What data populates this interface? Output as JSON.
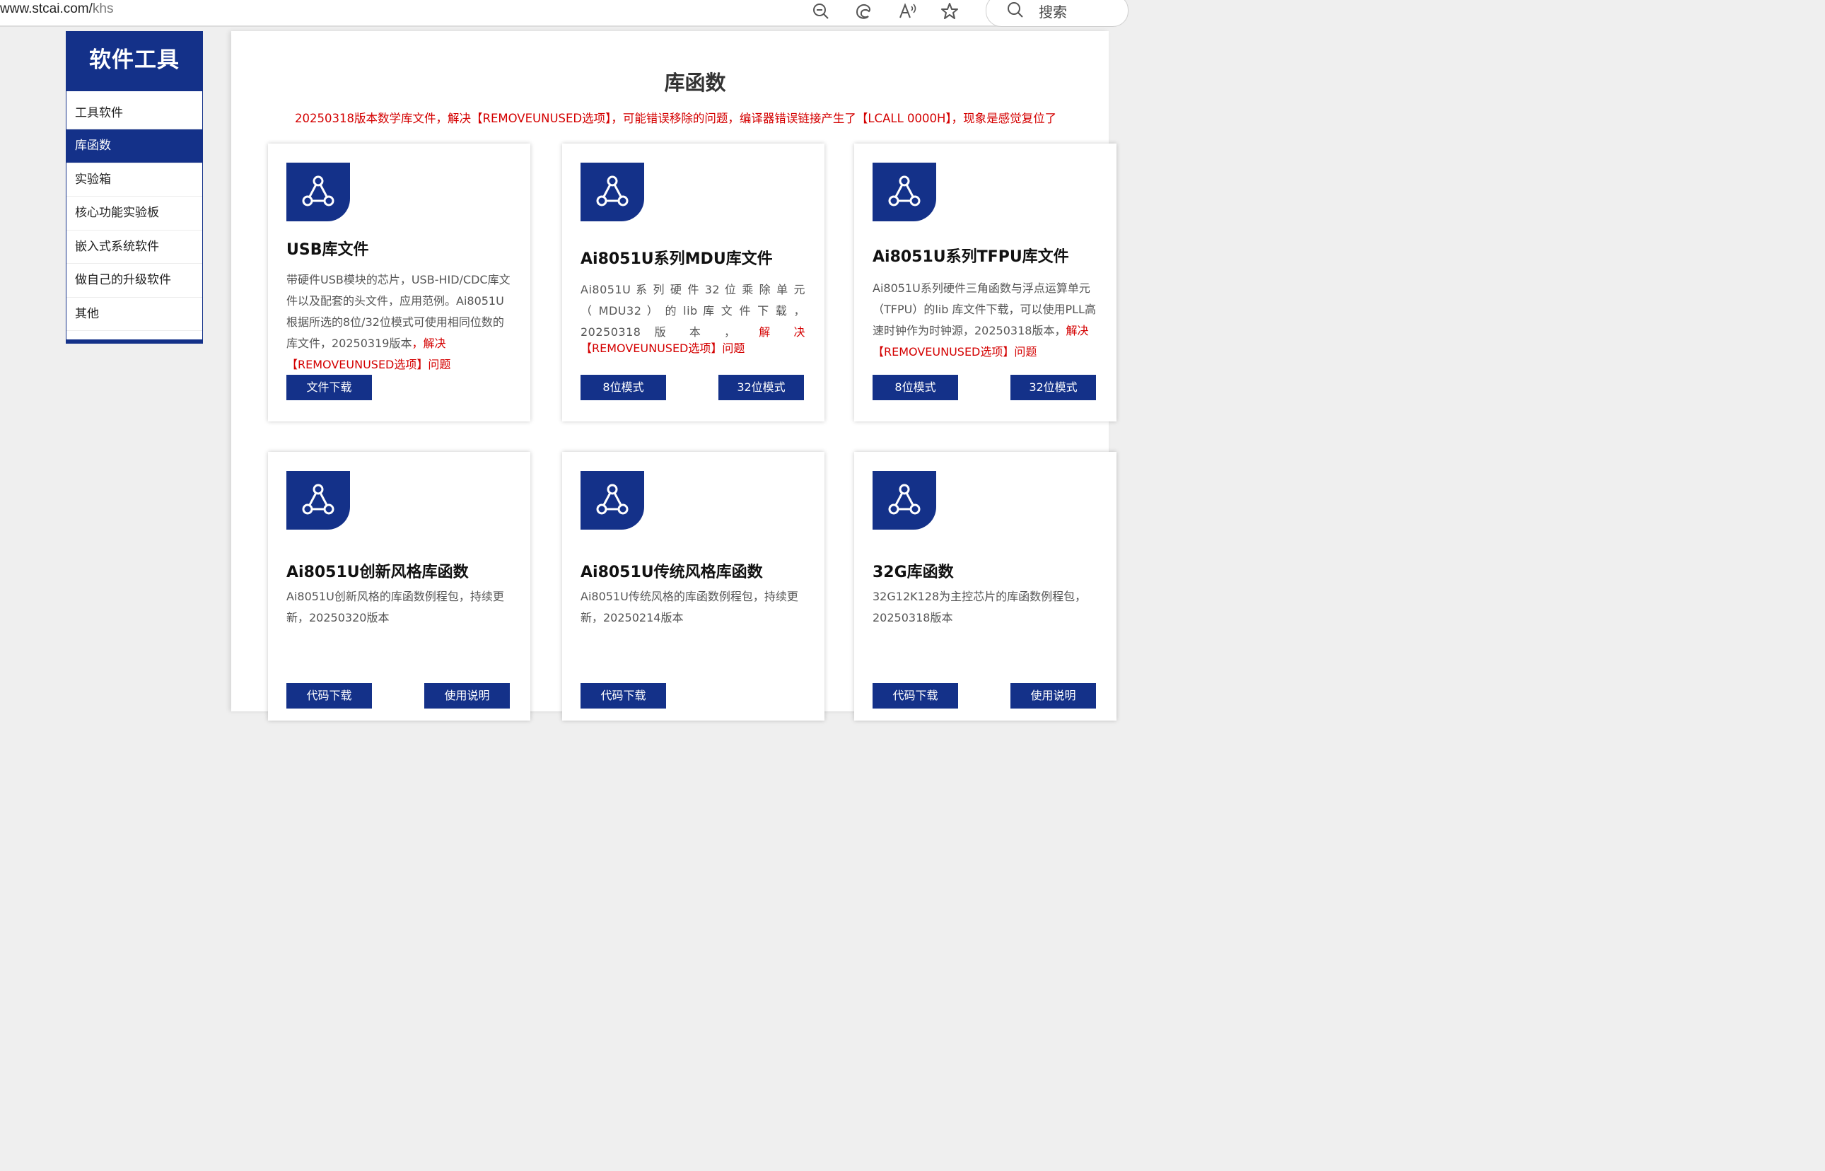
{
  "browser": {
    "url_host": "www.stcai.com/",
    "url_path": "khs",
    "search_label": "搜索"
  },
  "sidebar": {
    "title": "软件工具",
    "items": [
      {
        "label": "工具软件"
      },
      {
        "label": "库函数"
      },
      {
        "label": "实验箱"
      },
      {
        "label": "核心功能实验板"
      },
      {
        "label": "嵌入式系统软件"
      },
      {
        "label": "做自己的升级软件"
      },
      {
        "label": "其他"
      }
    ]
  },
  "main": {
    "title": "库函数",
    "notice": "20250318版本数学库文件，解决【REMOVEUNUSED选项】，可能错误移除的问题，编译器错误链接产生了【LCALL  0000H】，现象是感觉复位了",
    "cards": [
      {
        "title": "USB库文件",
        "desc": "带硬件USB模块的芯片，USB-HID/CDC库文件以及配套的头文件，应用范例。Ai8051U根据所选的8位/32位模式可使用相同位数的库文件，20250319版本",
        "desc_red": "，解决【REMOVEUNUSED选项】问题",
        "buttons": [
          "文件下载"
        ]
      },
      {
        "title": "Ai8051U系列MDU库文件",
        "desc": "Ai8051U 系 列 硬 件 32 位 乘 除 单 元 （ MDU32 ） 的 lib 库 文 件 下 载 ， 20250318 版 本 ，",
        "desc_red": "解 决",
        "desc_red2": "【REMOVEUNUSED选项】问题",
        "buttons": [
          "8位模式",
          "32位模式"
        ]
      },
      {
        "title": "Ai8051U系列TFPU库文件",
        "desc": "Ai8051U系列硬件三角函数与浮点运算单元（TFPU）的lib 库文件下载，可以使用PLL高速时钟作为时钟源，20250318版本，",
        "desc_red": "解决【REMOVEUNUSED选项】问题",
        "buttons": [
          "8位模式",
          "32位模式"
        ]
      },
      {
        "title": "Ai8051U创新风格库函数",
        "desc": "Ai8051U创新风格的库函数例程包，持续更新，20250320版本",
        "buttons": [
          "代码下载",
          "使用说明"
        ]
      },
      {
        "title": "Ai8051U传统风格库函数",
        "desc": "Ai8051U传统风格的库函数例程包，持续更新，20250214版本",
        "buttons": [
          "代码下载"
        ]
      },
      {
        "title": "32G库函数",
        "desc": "32G12K128为主控芯片的库函数例程包，20250318版本",
        "buttons": [
          "代码下载",
          "使用说明"
        ]
      }
    ]
  },
  "icons": {
    "card_icon": "connection-triangle-icon",
    "zoom": "zoom-out-icon",
    "edge": "edge-icon",
    "read_aloud": "read-aloud-icon",
    "favorite": "star-icon",
    "search": "search-icon"
  },
  "colors": {
    "brand": "#143189",
    "alert": "#d40000"
  }
}
